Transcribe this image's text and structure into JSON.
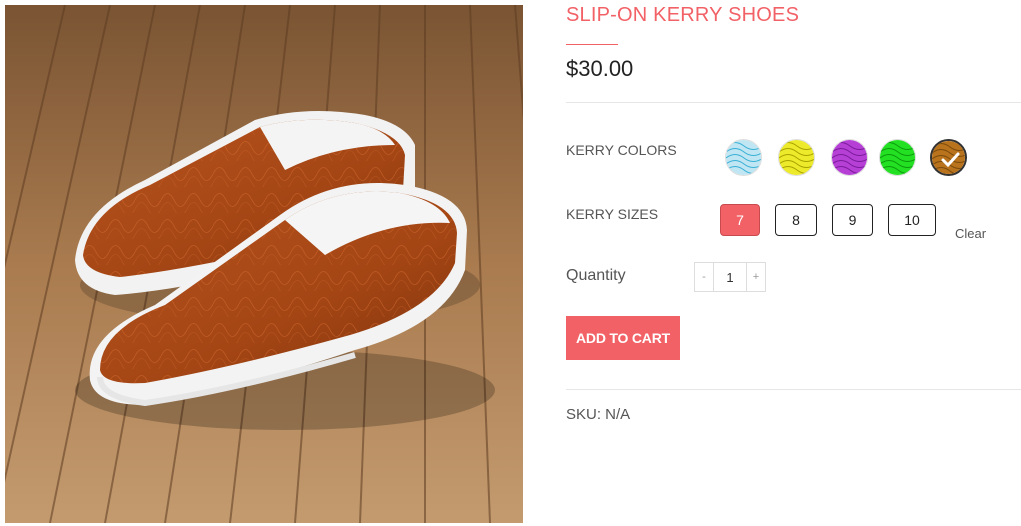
{
  "product": {
    "title": "SLIP-ON KERRY SHOES",
    "price": "$30.00",
    "image": {
      "icon": "slip-on-shoes-photo"
    }
  },
  "colors": {
    "label": "KERRY COLORS",
    "options": [
      {
        "name": "light blue",
        "color": "#bfe6f2",
        "line": "#3ab0d6",
        "selected": false
      },
      {
        "name": "yellow",
        "color": "#ecea2a",
        "line": "#a8a200",
        "selected": false
      },
      {
        "name": "purple",
        "color": "#b63fd6",
        "line": "#7a1c9a",
        "selected": false
      },
      {
        "name": "green",
        "color": "#23e023",
        "line": "#0c9a0c",
        "selected": false
      },
      {
        "name": "brown",
        "color": "#b8731c",
        "line": "#7a4a0c",
        "selected": true
      }
    ]
  },
  "sizes": {
    "label": "KERRY SIZES",
    "options": [
      "7",
      "8",
      "9",
      "10"
    ],
    "selected": "7",
    "clear_label": "Clear"
  },
  "quantity": {
    "label": "Quantity",
    "value": "1",
    "minus": "-",
    "plus": "+"
  },
  "cart": {
    "button_label": "ADD TO CART"
  },
  "meta": {
    "sku": "SKU: N/A"
  },
  "theme": {
    "accent": "#f26166"
  }
}
